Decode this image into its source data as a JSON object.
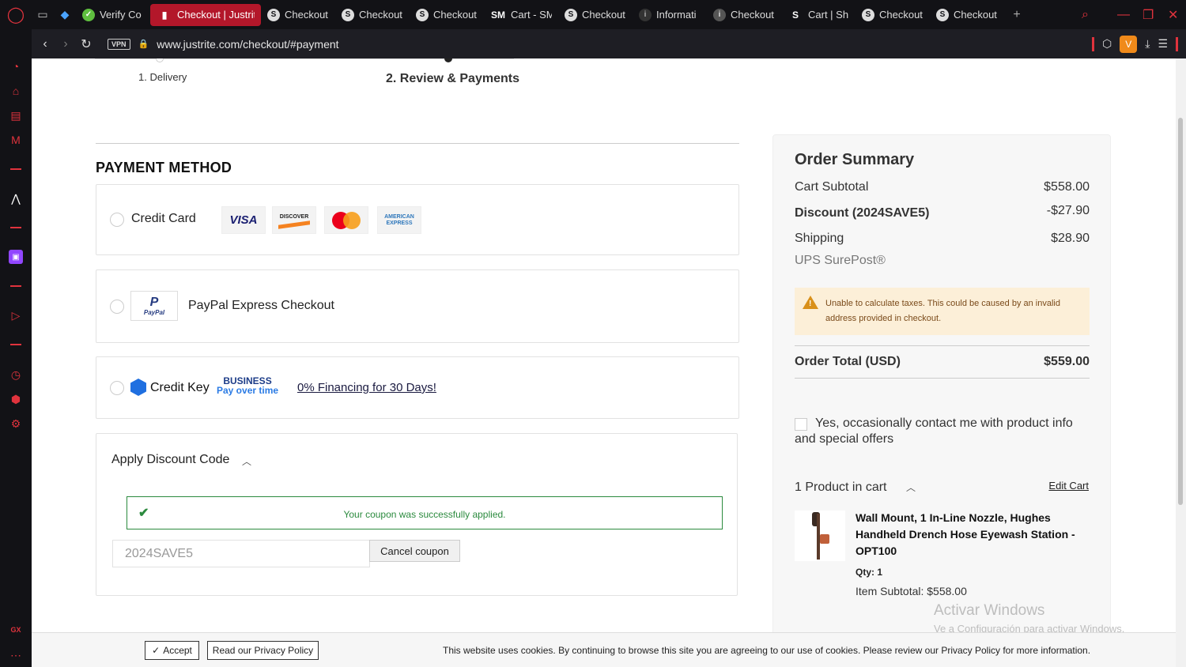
{
  "browser": {
    "tabs": [
      {
        "title": "Verify Co",
        "favicon": "V"
      },
      {
        "title": "Checkout | Justrit",
        "favicon": "J",
        "active": true
      },
      {
        "title": "Checkout",
        "favicon": "S"
      },
      {
        "title": "Checkout",
        "favicon": "S"
      },
      {
        "title": "Checkout",
        "favicon": "S"
      },
      {
        "title": "Cart - SM",
        "favicon": "SM"
      },
      {
        "title": "Checkout",
        "favicon": "S"
      },
      {
        "title": "Informati",
        "favicon": "i"
      },
      {
        "title": "Checkout",
        "favicon": "i"
      },
      {
        "title": "Cart | Sh",
        "favicon": "S"
      },
      {
        "title": "Checkout",
        "favicon": "S"
      },
      {
        "title": "Checkout",
        "favicon": "S"
      }
    ],
    "url": "www.justrite.com/checkout/#payment",
    "vpn_label": "VPN",
    "extension_letter": "V",
    "sidebar_bottom_label": "GX"
  },
  "steps": {
    "step1": "1. Delivery",
    "step2": "2. Review & Payments"
  },
  "payment": {
    "title": "PAYMENT METHOD",
    "credit_card_label": "Credit Card",
    "cards": {
      "visa": "VISA",
      "discover": "DISCOVER",
      "amex_line1": "AMERICAN",
      "amex_line2": "EXPRESS"
    },
    "paypal_logo_text": "PayPal",
    "paypal_label": "PayPal Express Checkout",
    "creditkey_label": "Credit Key",
    "creditkey_biz1": "BUSINESS",
    "creditkey_biz2": "Pay over time",
    "creditkey_link": "0% Financing for 30 Days!"
  },
  "discount": {
    "title": "Apply Discount Code",
    "success_message": "Your coupon was successfully applied.",
    "coupon_value": "2024SAVE5",
    "cancel_label": "Cancel coupon"
  },
  "summary": {
    "title": "Order Summary",
    "subtotal_label": "Cart Subtotal",
    "subtotal_value": "$558.00",
    "discount_label": "Discount (2024SAVE5)",
    "discount_value": "-$27.90",
    "shipping_label": "Shipping",
    "shipping_value": "$28.90",
    "shipping_method": "UPS SurePost®",
    "warning": "Unable to calculate taxes. This could be caused by an invalid address provided in checkout.",
    "total_label": "Order Total (USD)",
    "total_value": "$559.00",
    "optin_label": "Yes, occasionally contact me with product info and special offers",
    "products_in_cart": "1 Product in cart",
    "edit_cart": "Edit Cart",
    "product_name": "Wall Mount, 1 In-Line Nozzle, Hughes Handheld Drench Hose Eyewash Station - OPT100",
    "product_qty": "Qty: 1",
    "product_subtotal": "Item Subtotal: $558.00"
  },
  "watermark": {
    "line1": "Activar Windows",
    "line2": "Ve a Configuración para activar Windows."
  },
  "cookie": {
    "accept_label": "Accept",
    "privacy_label": "Read our Privacy Policy",
    "message": "This website uses cookies. By continuing to browse this site you are agreeing to our use of cookies. Please review our Privacy Policy for more information."
  }
}
